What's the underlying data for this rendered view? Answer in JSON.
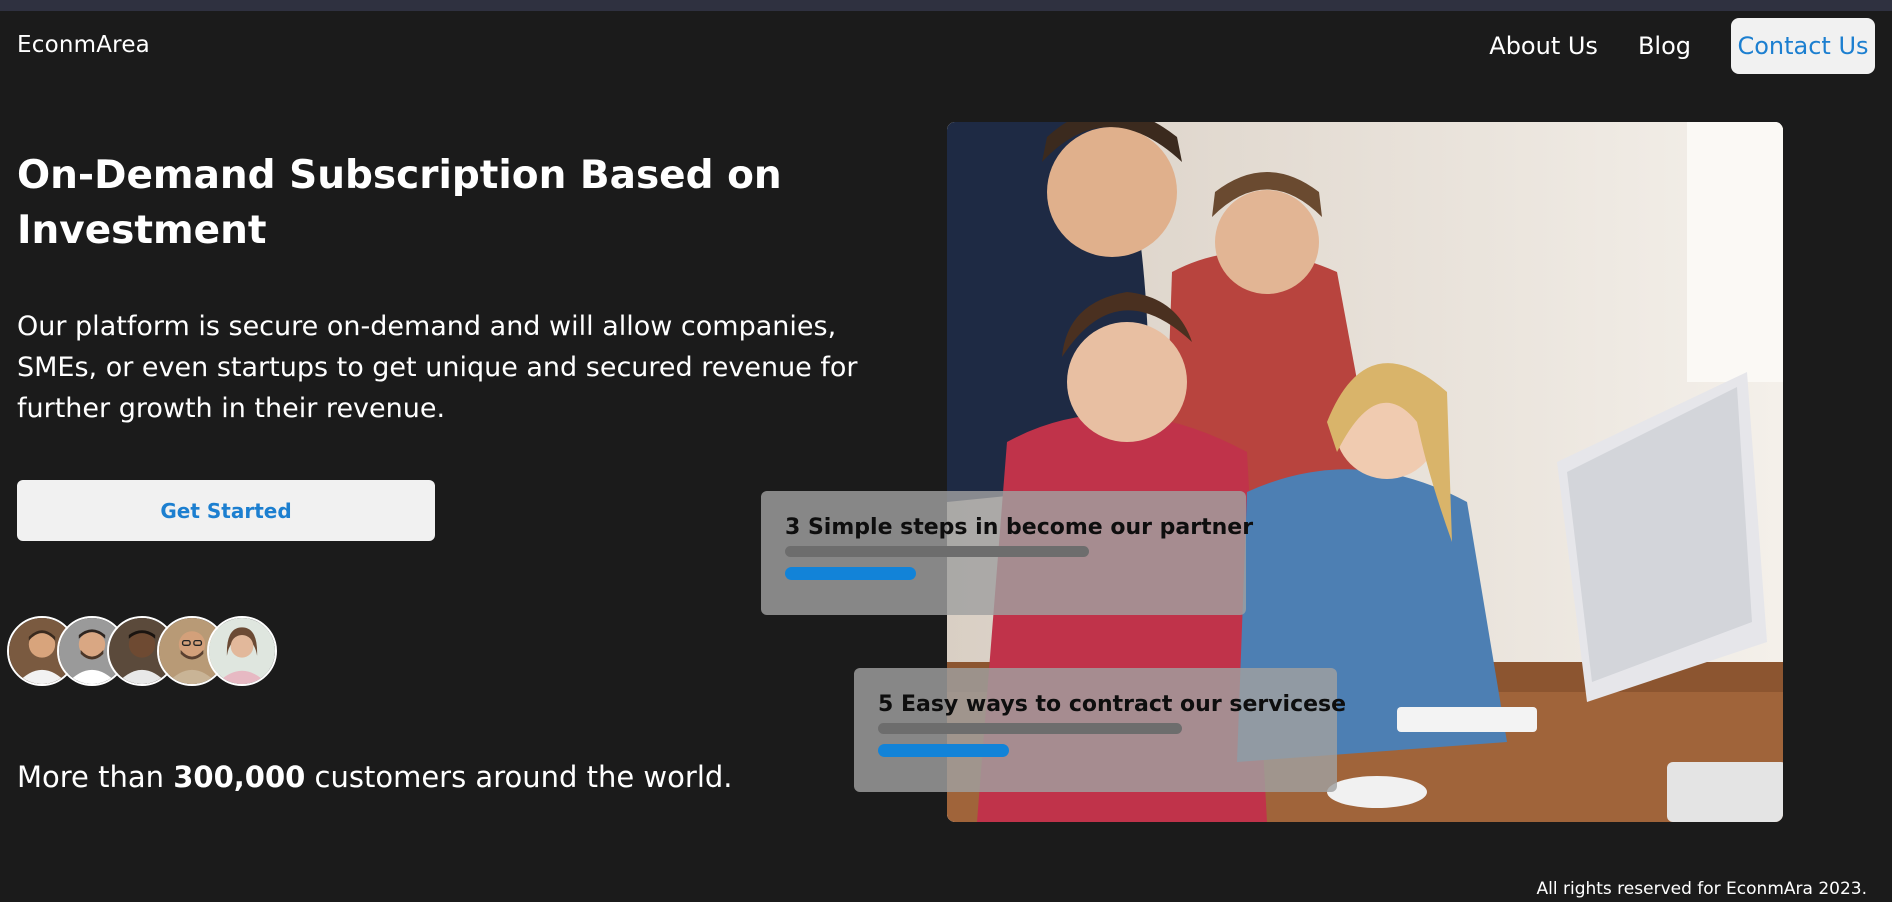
{
  "brand": "EconmArea",
  "nav": {
    "about": "About Us",
    "blog": "Blog",
    "contact": "Contact Us"
  },
  "hero": {
    "headline_line1": "On-Demand Subscription Based on",
    "headline_line2": "Investment",
    "description": "Our platform is secure on-demand and will allow companies, SMEs, or even startups to get unique and secured revenue for further growth in their revenue.",
    "cta": "Get Started"
  },
  "customers": {
    "prefix": "More than",
    "count": "300,000",
    "suffix": "customers around the world."
  },
  "cards": [
    {
      "title": "3 Simple steps in become our partner",
      "progress": 0.43
    },
    {
      "title": "5 Easy ways to contract our servicese",
      "progress": 0.43
    }
  ],
  "footer": "All rights reserved for EconmAra 2023.",
  "colors": {
    "background": "#1b1b1b",
    "accent": "#1c7fd0",
    "button_bg": "#f1f1f1",
    "progress_fill": "#1283d8",
    "progress_track": "#6d6d6d"
  }
}
